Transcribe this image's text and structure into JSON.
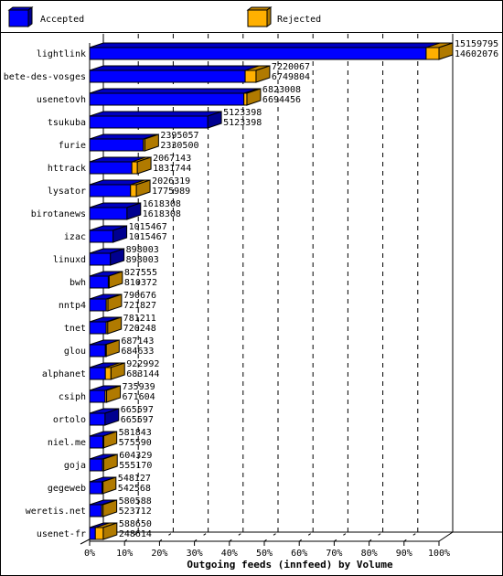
{
  "chart_data": {
    "type": "bar",
    "orientation": "horizontal",
    "stacked": true,
    "three_d": true,
    "title": "Outgoing feeds (innfeed) by Volume",
    "xlabel": "Outgoing feeds (innfeed) by Volume",
    "ylabel": "",
    "xlim_percent": [
      0,
      100
    ],
    "max_value": 15159795,
    "x_ticks": [
      "0%",
      "10%",
      "20%",
      "30%",
      "40%",
      "50%",
      "60%",
      "70%",
      "80%",
      "90%",
      "100%"
    ],
    "grid": true,
    "legend_position": "top",
    "legend": [
      {
        "name": "Accepted",
        "color": "#0000ff"
      },
      {
        "name": "Rejected",
        "color": "#ffb000"
      }
    ],
    "categories": [
      "lightlink",
      "bete-des-vosges",
      "usenetovh",
      "tsukuba",
      "furie",
      "httrack",
      "lysator",
      "birotanews",
      "izac",
      "linuxd",
      "bwh",
      "nntp4",
      "tnet",
      "glou",
      "alphanet",
      "csiph",
      "ortolo",
      "niel.me",
      "goja",
      "gegeweb",
      "weretis.net",
      "usenet-fr"
    ],
    "totals": [
      15159795,
      7220067,
      6823008,
      5123398,
      2395057,
      2067143,
      2026319,
      1618308,
      1015467,
      898003,
      827555,
      790676,
      781211,
      687143,
      922992,
      735939,
      665597,
      581843,
      604329,
      548127,
      580588,
      588650
    ],
    "accepted": [
      14602076,
      6749804,
      6694456,
      5123398,
      2330500,
      1831744,
      1775989,
      1618308,
      1015467,
      898003,
      810372,
      721827,
      720248,
      684633,
      683144,
      671604,
      665597,
      575590,
      555170,
      542568,
      523712,
      248614
    ],
    "series": [
      {
        "name": "Accepted",
        "values": [
          14602076,
          6749804,
          6694456,
          5123398,
          2330500,
          1831744,
          1775989,
          1618308,
          1015467,
          898003,
          810372,
          721827,
          720248,
          684633,
          683144,
          671604,
          665597,
          575590,
          555170,
          542568,
          523712,
          248614
        ]
      },
      {
        "name": "Rejected",
        "values": [
          557719,
          470263,
          128552,
          0,
          64557,
          235399,
          250330,
          0,
          0,
          0,
          17183,
          68849,
          60963,
          2510,
          239848,
          64335,
          0,
          6253,
          49159,
          5559,
          56876,
          340036
        ]
      }
    ]
  }
}
